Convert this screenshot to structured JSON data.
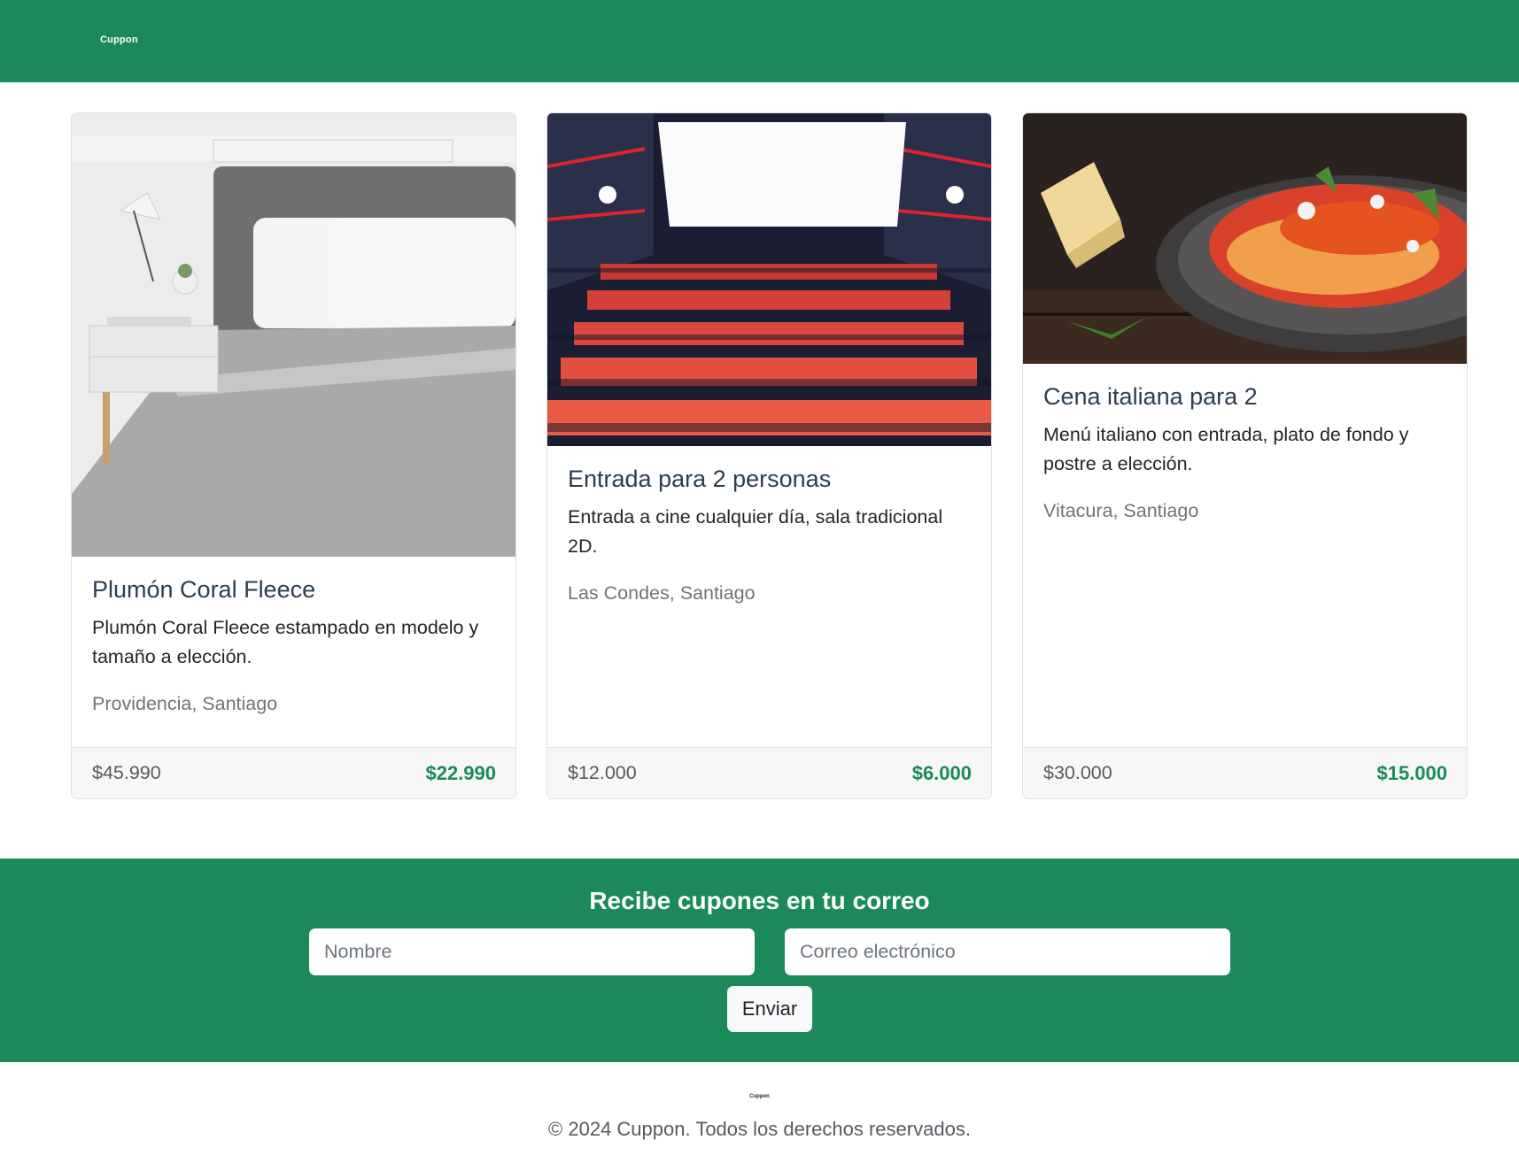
{
  "header": {
    "brand": "Cuppon",
    "background": "#1b8a58"
  },
  "cards": [
    {
      "image_icon": "bed-comforter-image",
      "title": "Plumón Coral Fleece",
      "description": "Plumón Coral Fleece estampado en modelo y tamaño a elección.",
      "location": "Providencia, Santiago",
      "price_old": "$45.990",
      "price_new": "$22.990"
    },
    {
      "image_icon": "cinema-seats-image",
      "title": "Entrada para 2 personas",
      "description": "Entrada a cine cualquier día, sala tradicional 2D.",
      "location": "Las Condes, Santiago",
      "price_old": "$12.000",
      "price_new": "$6.000"
    },
    {
      "image_icon": "spaghetti-dish-image",
      "title": "Cena italiana para 2",
      "description": "Menú italiano con entrada, plato de fondo y postre a elección.",
      "location": "Vitacura, Santiago",
      "price_old": "$30.000",
      "price_new": "$15.000"
    }
  ],
  "newsletter": {
    "title": "Recibe cupones en tu correo",
    "name_placeholder": "Nombre",
    "email_placeholder": "Correo electrónico",
    "submit_label": "Enviar"
  },
  "footer": {
    "brand": "Cuppon",
    "copyright": "© 2024 Cuppon. Todos los derechos reservados."
  },
  "colors": {
    "accent": "#1b8a58",
    "title": "#2c3e50",
    "muted": "#6c757d"
  }
}
